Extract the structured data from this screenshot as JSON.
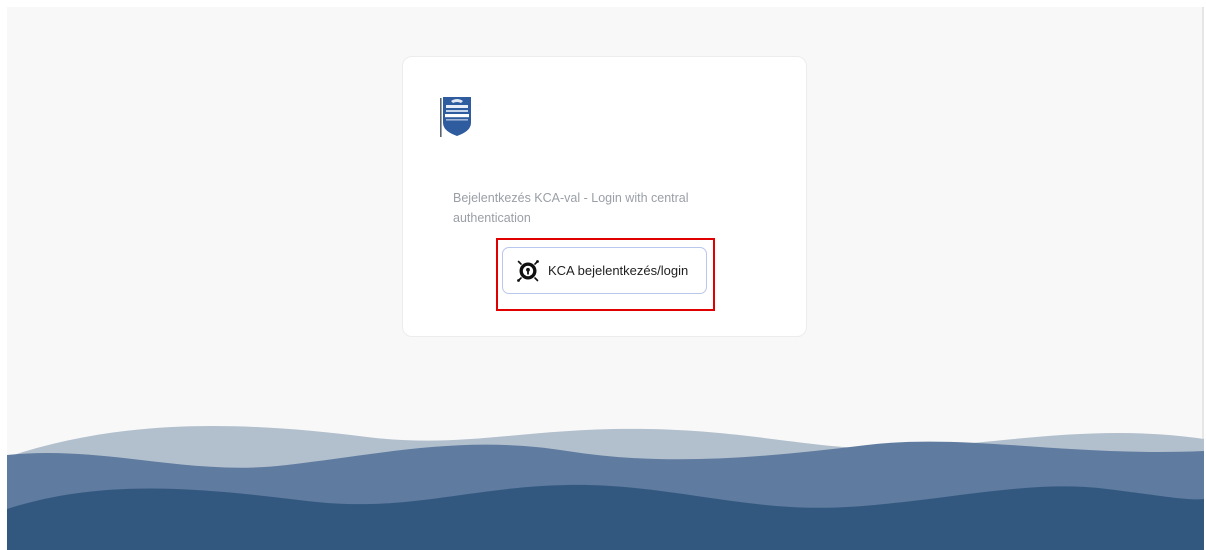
{
  "login": {
    "subtitle": "Bejelentkezés KCA-val - Login with central authentication",
    "button_label": "KCA bejelentkezés/login"
  },
  "icons": {
    "logo": "university-shield-logo",
    "button": "keyhole-badge-icon"
  },
  "colors": {
    "page_background": "#f8f8f8",
    "card_background": "#ffffff",
    "highlight_border": "#e10000",
    "button_border": "#b9c6ee",
    "wave_light": "#b2bfcd",
    "wave_mid": "#5f7b9f",
    "wave_dark": "#33587f"
  }
}
